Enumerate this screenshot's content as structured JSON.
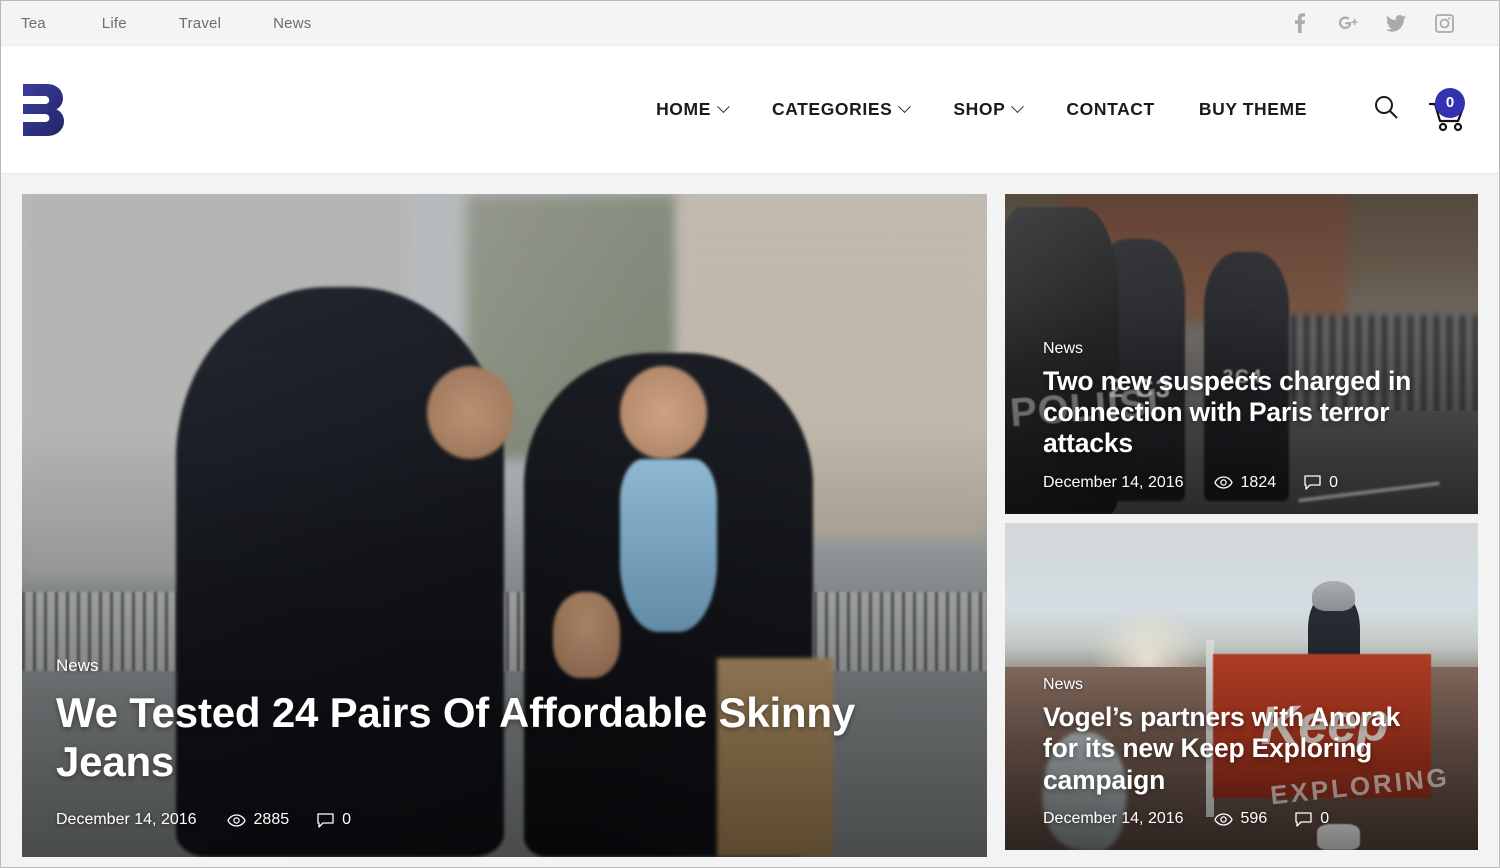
{
  "topbar": {
    "links": [
      {
        "label": "Tea"
      },
      {
        "label": "Life"
      },
      {
        "label": "Travel"
      },
      {
        "label": "News"
      }
    ],
    "social": [
      {
        "name": "facebook-icon",
        "label": "Facebook"
      },
      {
        "name": "google-plus-icon",
        "label": "Google Plus"
      },
      {
        "name": "twitter-icon",
        "label": "Twitter"
      },
      {
        "name": "instagram-icon",
        "label": "Instagram"
      }
    ]
  },
  "header": {
    "logo_alt": "B",
    "logo_color": "#2f3193",
    "nav": [
      {
        "label": "HOME",
        "has_dropdown": true
      },
      {
        "label": "CATEGORIES",
        "has_dropdown": true
      },
      {
        "label": "SHOP",
        "has_dropdown": true
      },
      {
        "label": "CONTACT",
        "has_dropdown": false
      },
      {
        "label": "BUY THEME",
        "has_dropdown": false
      }
    ],
    "search_icon": "search-icon",
    "cart": {
      "icon": "shopping-cart-icon",
      "count": "0",
      "badge_color": "#3333b2"
    }
  },
  "hero": {
    "category": "News",
    "title": "We Tested 24 Pairs Of Affordable Skinny Jeans",
    "date": "December 14, 2016",
    "views": "2885",
    "comments": "0",
    "image_alt": "Two young men in winter coats and beanies talking outdoors in a city plaza"
  },
  "side_cards": [
    {
      "category": "News",
      "title": "Two new suspects charged in connection with Paris terror attacks",
      "date": "December 14, 2016",
      "views": "1824",
      "comments": "0",
      "image_alt": "Riot police officers marked POLIISI facing a crowd of demonstrators",
      "image_text_1": "POLIISI",
      "image_text_2": "2 C3",
      "image_text_3": "2C4"
    },
    {
      "category": "News",
      "title": "Vogel’s partners with Anorak for its new Keep Exploring campaign",
      "date": "December 14, 2016",
      "views": "596",
      "comments": "0",
      "image_alt": "Person on a canyon overlook holding a large red Keep Exploring flag at sunrise",
      "image_text_1": "Keep",
      "image_text_2": "EXPLORING"
    }
  ]
}
